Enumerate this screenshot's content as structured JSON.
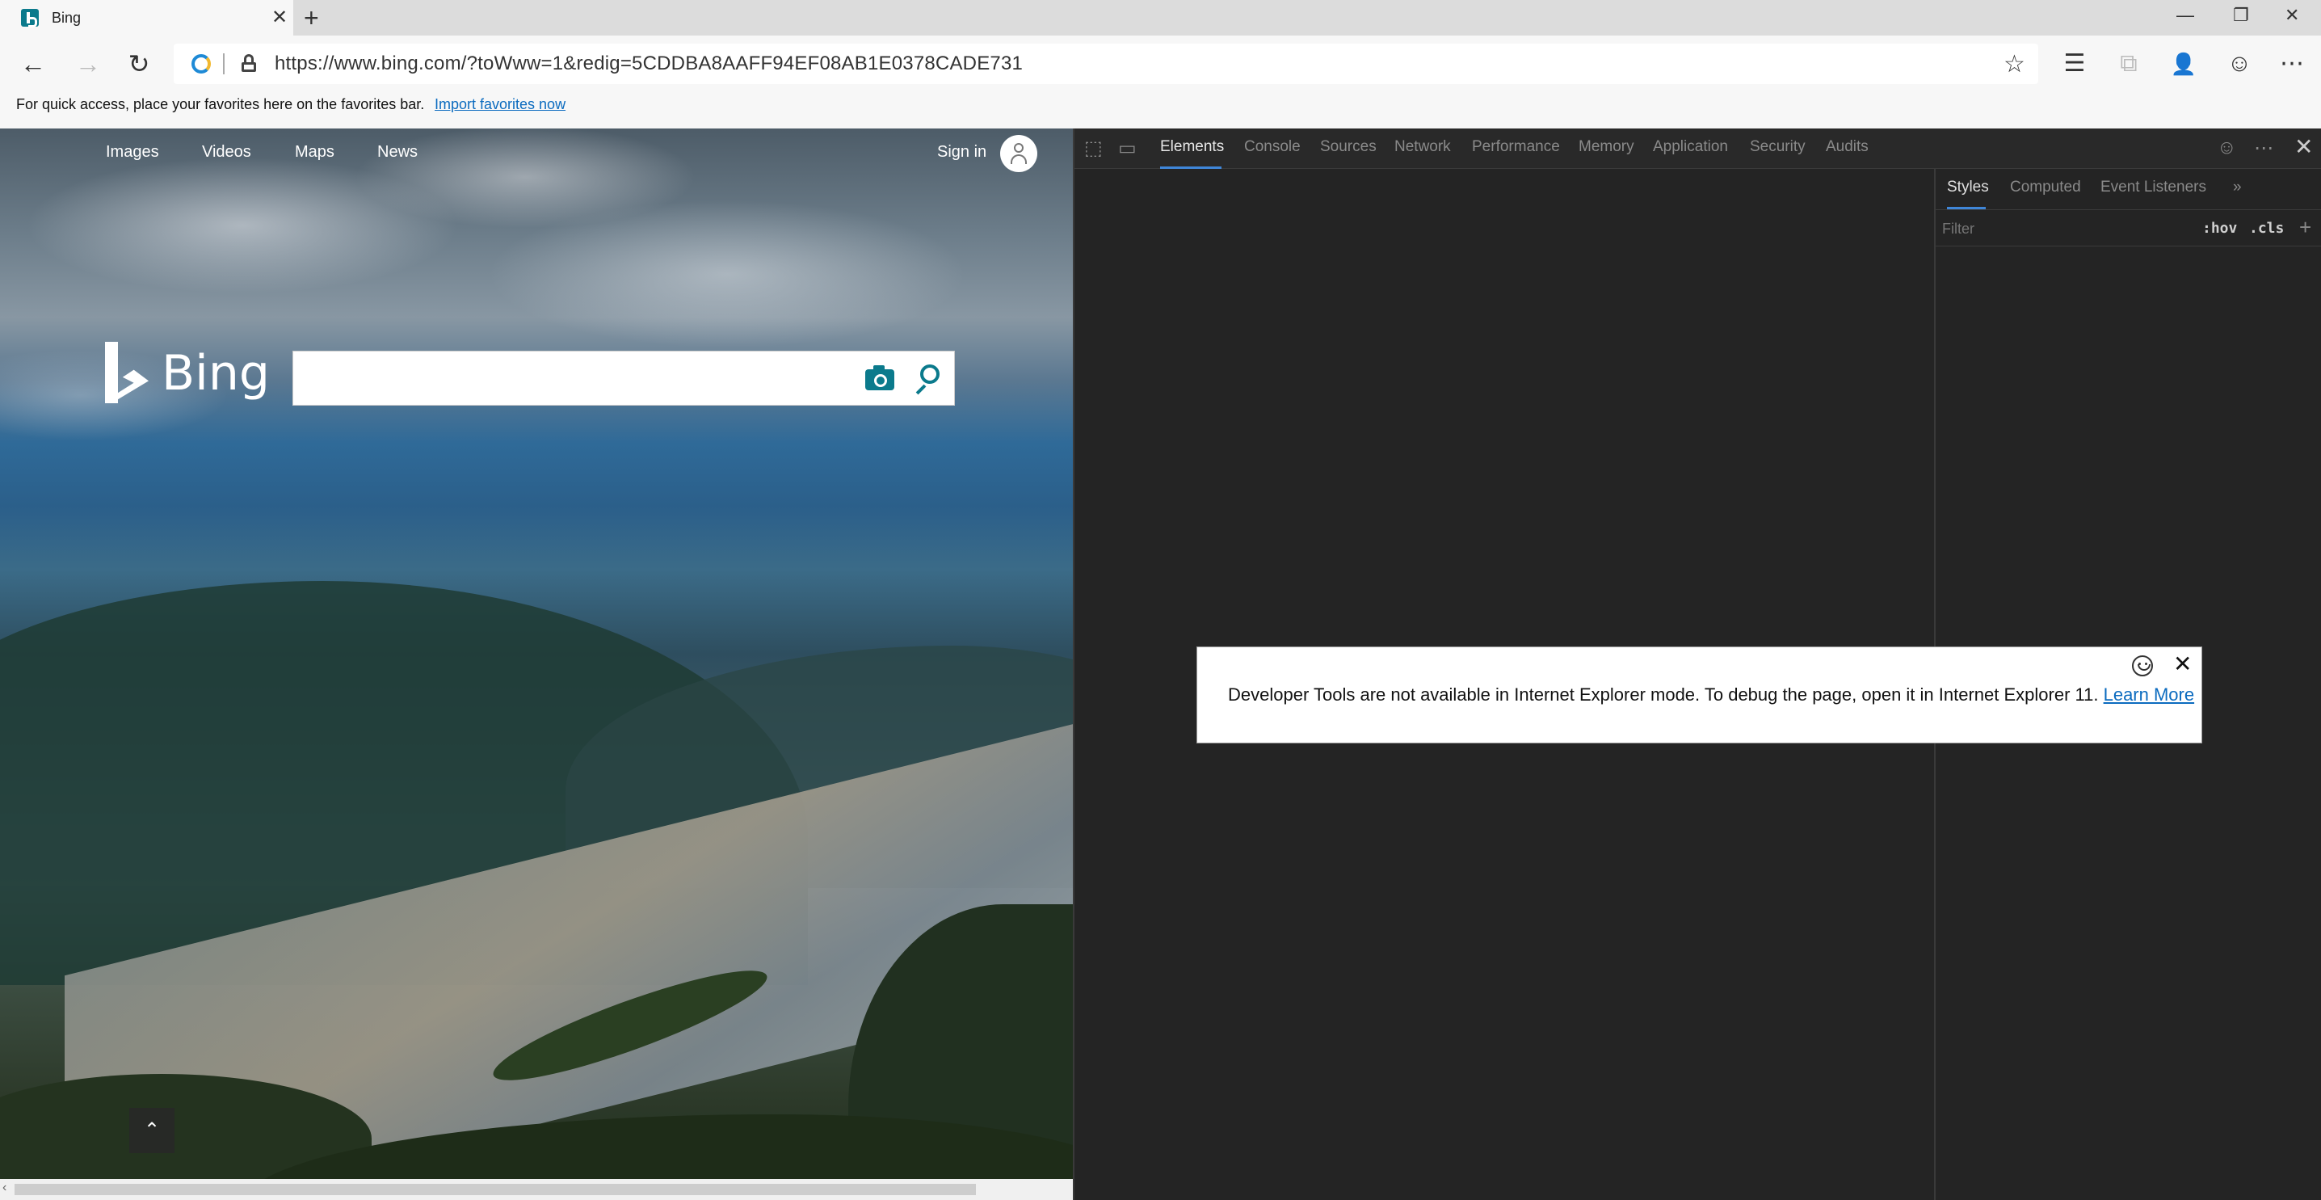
{
  "browser": {
    "tab": {
      "title": "Bing",
      "close_glyph": "✕",
      "icon": "bing-favicon"
    },
    "new_tab_glyph": "+",
    "window_controls": {
      "minimize": "—",
      "restore": "❐",
      "close": "✕"
    },
    "nav": {
      "back": "←",
      "forward": "→",
      "refresh": "↻"
    },
    "address": {
      "url": "https://www.bing.com/?toWww=1&redig=5CDDBA8AAFF94EF08AB1E0378CADE731",
      "mode_icon": "internet-explorer-icon",
      "lock_icon": "lock-icon"
    },
    "toolbar_icons": {
      "favorite": "☆",
      "favorites_list": "☰",
      "collections": "⧉",
      "profile": "👤",
      "feedback": "☺",
      "more": "⋯"
    },
    "favorites_bar": {
      "message": "For quick access, place your favorites here on the favorites bar.",
      "import_link": "Import favorites now"
    }
  },
  "bing": {
    "nav": [
      "Images",
      "Videos",
      "Maps",
      "News"
    ],
    "sign_in": "Sign in",
    "logo_text": "Bing",
    "search": {
      "value": "",
      "placeholder": ""
    },
    "scroll_up_glyph": "⌃"
  },
  "devtools": {
    "tabs": [
      "Elements",
      "Console",
      "Sources",
      "Network",
      "Performance",
      "Memory",
      "Application",
      "Security",
      "Audits"
    ],
    "active_tab": "Elements",
    "close_glyph": "✕",
    "more_glyph": "⋯",
    "styles_pane": {
      "tabs": [
        "Styles",
        "Computed",
        "Event Listeners"
      ],
      "overflow_glyph": "»",
      "filter_placeholder": "Filter",
      "hov": ":hov",
      "cls": ".cls",
      "plus": "+"
    },
    "notice": {
      "message": "Developer Tools are not available in Internet Explorer mode. To debug the page, open it in Internet Explorer 11.",
      "link": "Learn More",
      "close_glyph": "✕"
    }
  },
  "colors": {
    "accent": "#0b7a8c",
    "link": "#0b6bbf",
    "devtools_bg": "#242424",
    "active_tab_underline": "#3f86d8"
  }
}
